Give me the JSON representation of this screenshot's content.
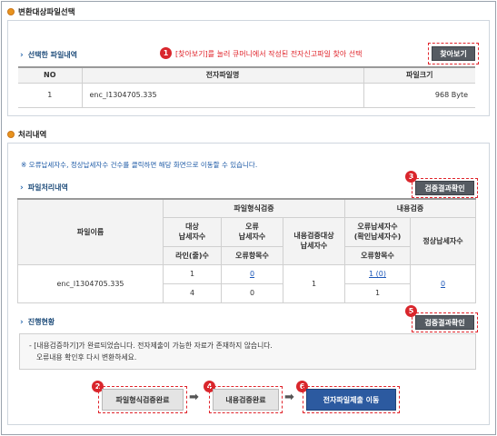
{
  "section1": {
    "title": "변환대상파일선택",
    "sub_title": "선택한 파일내역",
    "instruction": "[찾아보기]를 눌러 큐머니에서 작성된 전자신고파일 찾아 선택",
    "browse_button": "찾아보기",
    "badge": "1",
    "table": {
      "headers": [
        "NO",
        "전자파일명",
        "파일크기"
      ],
      "rows": [
        {
          "no": "1",
          "name": "enc_l1304705.335",
          "size": "968 Byte"
        }
      ]
    }
  },
  "section2": {
    "title": "처리내역",
    "notice": "※ 오류납세자수, 정상납세자수 건수를 클릭하면 해당 화면으로 이동할 수 있습니다.",
    "sub_title": "파일처리내역",
    "check_button": "검증결과확인",
    "badge3": "3",
    "table": {
      "h_filename": "파일이름",
      "h_format_check": "파일형식검증",
      "h_content_check": "내용검증",
      "h_target_1": "대상",
      "h_target_2": "납세자수",
      "h_error_1": "오류",
      "h_error_2": "납세자수",
      "h_content_target_1": "내용검증대상",
      "h_content_target_2": "납세자수",
      "h_err_confirm_1": "오류납세자수",
      "h_err_confirm_2": "(확인납세자수)",
      "h_normal": "정상납세자수",
      "h_lines": "라인(줄)수",
      "h_err_items": "오류항목수",
      "h_err_items2": "오류항목수",
      "row": {
        "filename": "enc_l1304705.335",
        "target": "1",
        "error": "0",
        "content_target": "1",
        "err_confirm": "1 (0)",
        "normal": "0",
        "lines": "4",
        "err_items": "0",
        "err_items2": "1"
      }
    },
    "progress_title": "진행현황",
    "check_button2": "검증결과확인",
    "badge5": "5",
    "status_line1": "- [내용검증하기]가 완료되었습니다. 전자제출이 가능한 자료가 존재하지 않습니다.",
    "status_line2": "오류내용 확인후 다시 변환하세요."
  },
  "steps": {
    "step1": "파일형식검증완료",
    "badge2": "2",
    "step2": "내용검증완료",
    "badge4": "4",
    "step3": "전자파일제출 이동",
    "badge6": "6"
  },
  "colors": {
    "accent_blue": "#2c5aa0",
    "badge_red": "#d9262c",
    "link_blue": "#1c57b8"
  }
}
